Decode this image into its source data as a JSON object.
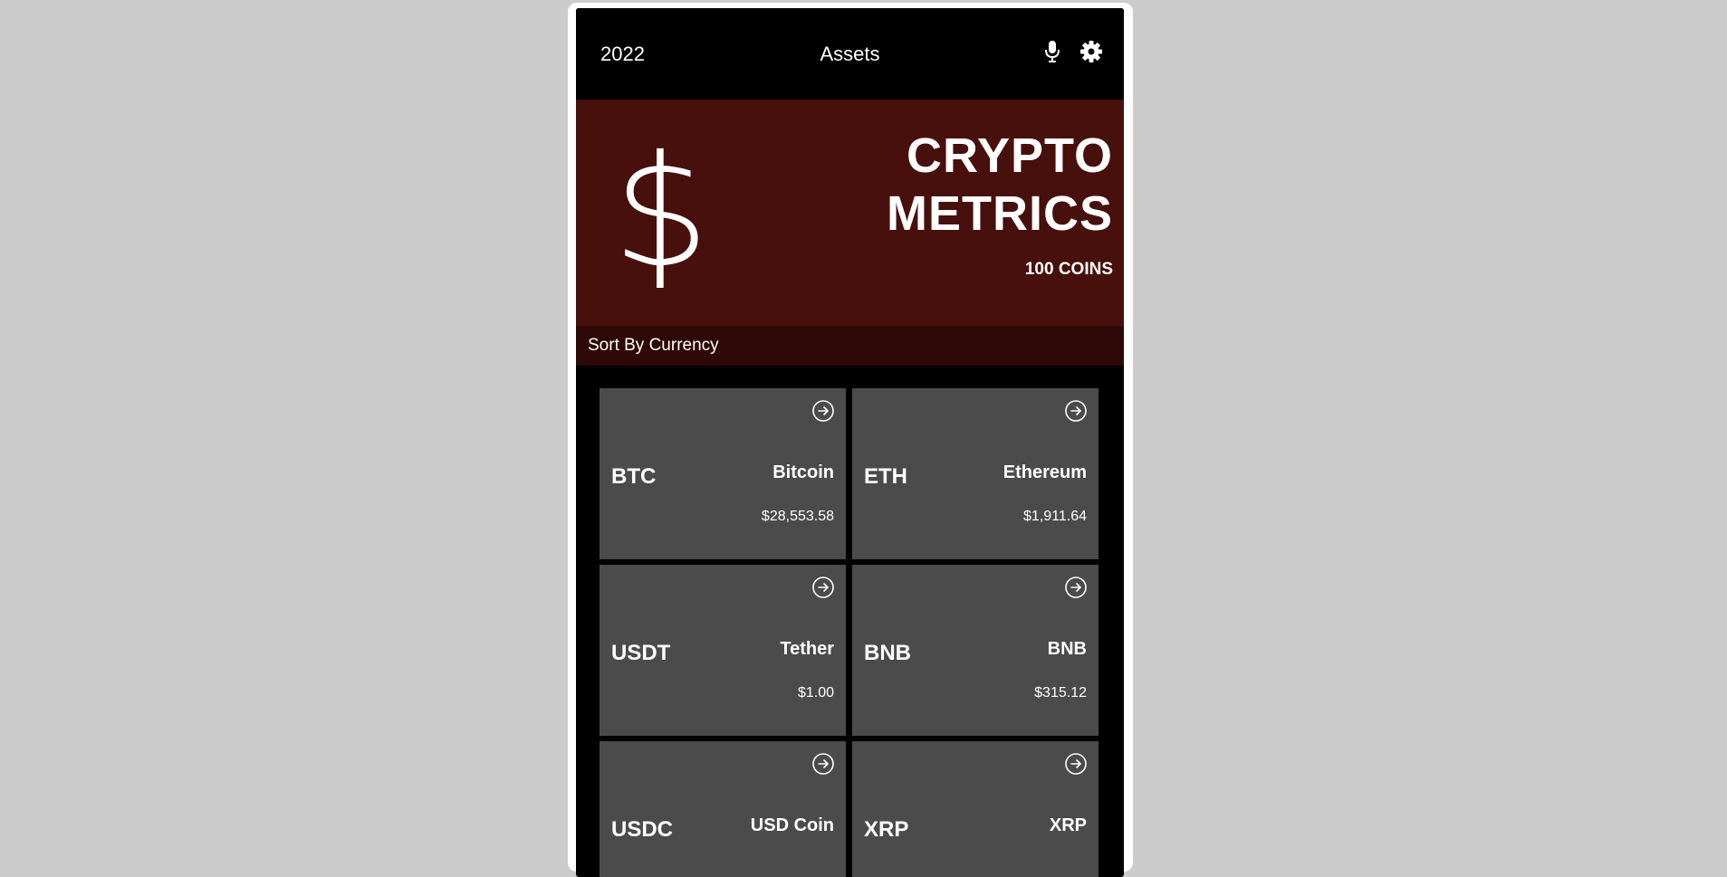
{
  "appbar": {
    "year": "2022",
    "title": "Assets",
    "mic_icon": "microphone-icon",
    "settings_icon": "gear-icon"
  },
  "hero": {
    "symbol": "$",
    "title_line1": "CRYPTO",
    "title_line2": "METRICS",
    "count": "100 COINS",
    "background": "#47100d"
  },
  "sort": {
    "label": "Sort By Currency",
    "background": "#2e0806"
  },
  "coins": [
    {
      "symbol": "BTC",
      "name": "Bitcoin",
      "price": "$28,553.58"
    },
    {
      "symbol": "ETH",
      "name": "Ethereum",
      "price": "$1,911.64"
    },
    {
      "symbol": "USDT",
      "name": "Tether",
      "price": "$1.00"
    },
    {
      "symbol": "BNB",
      "name": "BNB",
      "price": "$315.12"
    },
    {
      "symbol": "USDC",
      "name": "USD Coin",
      "price": ""
    },
    {
      "symbol": "XRP",
      "name": "XRP",
      "price": ""
    }
  ],
  "colors": {
    "page_background": "#cccccc",
    "card_background": "#4b4b4b",
    "text": "#ffffff"
  }
}
